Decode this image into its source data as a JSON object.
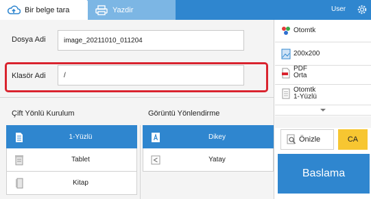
{
  "tabs": {
    "scan_label": "Bir belge tara",
    "print_label": "Yazdir"
  },
  "header": {
    "user_label": "User"
  },
  "form": {
    "file_name_label": "Dosya Adi",
    "file_name_value": "image_20211010_011204",
    "folder_name_label": "Klasör Adi",
    "folder_name_value": "/"
  },
  "duplex": {
    "title": "Çift Yönlü Kurulum",
    "options": [
      {
        "label": "1-Yüzlü",
        "icon": "single-sided-icon",
        "selected": true
      },
      {
        "label": "Tablet",
        "icon": "tablet-icon",
        "selected": false
      },
      {
        "label": "Kitap",
        "icon": "book-icon",
        "selected": false
      }
    ]
  },
  "orientation": {
    "title": "Görüntü Yönlendirme",
    "options": [
      {
        "label": "Dikey",
        "icon": "portrait-icon",
        "selected": true
      },
      {
        "label": "Yatay",
        "icon": "landscape-icon",
        "selected": false
      }
    ]
  },
  "settings": {
    "color_mode": "Otomtk",
    "resolution": "200x200",
    "format_line1": "PDF",
    "format_line2": "Orta",
    "sides_line1": "Otomtk",
    "sides_line2": "1-Yüzlü"
  },
  "actions": {
    "preview_label": "Önizle",
    "ca_label": "CA",
    "start_label": "Baslama"
  },
  "colors": {
    "accent": "#2f86cf",
    "highlight": "#d9232e",
    "ca": "#f7c631"
  }
}
